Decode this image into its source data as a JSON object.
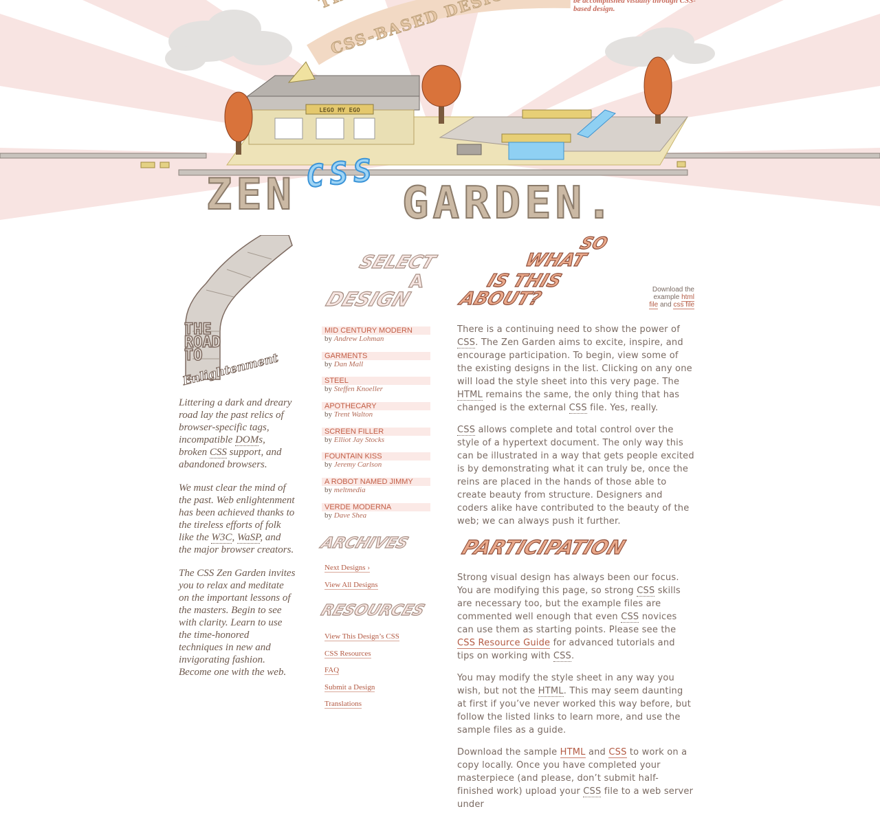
{
  "header": {
    "tagline_small": "be accomplished visually through CSS-based design.",
    "arc_line1": "THE BEAUTY OF CSS DESIGN",
    "arc_line2": "CSS-BASED DESIGN",
    "title_zen": "ZEN",
    "title_css": "CSS",
    "title_garden": "GARDEN.",
    "sign_text": "LEGO MY EGO",
    "colors": {
      "sky_rays": "#f8e4e2",
      "brick_gray": "#b8b0a8",
      "brick_yellow": "#e8d17a",
      "brick_blue": "#8ecdf2",
      "tree_orange": "#d9733b"
    }
  },
  "left": {
    "road_caption": [
      "THE",
      "ROAD",
      "TO"
    ],
    "road_enlight": "Enlightenment",
    "p1_a": "Littering a dark and dreary road lay the past relics of browser-specific tags, incompatible ",
    "p1_dom": "DOM",
    "p1_b": "s, broken ",
    "p1_css": "CSS",
    "p1_c": " support, and abandoned browsers.",
    "p2_a": "We must clear the mind of the past. Web enlightenment has been achieved thanks to the tireless efforts of folk like the ",
    "p2_w3c": "W3C",
    "p2_sep": ", ",
    "p2_wasp": "WaSP",
    "p2_b": ", and the major browser creators.",
    "p3": "The CSS Zen Garden invites you to relax and meditate on the important lessons of the masters. Begin to see with clarity. Learn to use the time-honored techniques in new and invigorating fashion. Become one with the web."
  },
  "mid": {
    "select_heading": [
      "SELECT",
      "A",
      "DESIGN"
    ],
    "by_label": "by",
    "designs": [
      {
        "name": "Mid Century Modern",
        "author": "Andrew Lohman"
      },
      {
        "name": "Garments",
        "author": "Dan Mall"
      },
      {
        "name": "Steel",
        "author": "Steffen Knoeller"
      },
      {
        "name": "Apothecary",
        "author": "Trent Walton"
      },
      {
        "name": "Screen Filler",
        "author": "Elliot Jay Stocks"
      },
      {
        "name": "Fountain Kiss",
        "author": "Jeremy Carlson"
      },
      {
        "name": "A Robot Named Jimmy",
        "author": "meltmedia"
      },
      {
        "name": "Verde Moderna",
        "author": "Dave Shea"
      }
    ],
    "archives_heading": "ARCHIVES",
    "archives_links": [
      "Next Designs ›",
      "View All Designs"
    ],
    "resources_heading": "RESOURCES",
    "resources_links": [
      "View This Design’s CSS",
      "CSS Resources",
      "FAQ",
      "Submit a Design",
      "Translations"
    ]
  },
  "right": {
    "about_heading": [
      "SO",
      "WHAT",
      "IS THIS",
      "ABOUT?"
    ],
    "download": {
      "prefix": "Download the example",
      "html_link": "html file",
      "and": "and",
      "css_link": "css file"
    },
    "p1_a": "There is a continuing need to show the power of ",
    "p1_css": "CSS",
    "p1_b": ". The Zen Garden aims to excite, inspire, and encourage participation. To begin, view some of the existing designs in the list. Clicking on any one will load the style sheet into this very page. The ",
    "p1_html": "HTML",
    "p1_c": " remains the same, the only thing that has changed is the external ",
    "p1_css2": "CSS",
    "p1_d": " file. Yes, really.",
    "p2_css": "CSS",
    "p2_a": " allows complete and total control over the style of a hypertext document. The only way this can be illustrated in a way that gets people excited is by demonstrating what it can truly be, once the reins are placed in the hands of those able to create beauty from structure. Designers and coders alike have contributed to the beauty of the web; we can always push it further.",
    "participation_heading": "PARTICIPATION",
    "p3_a": "Strong visual design has always been our focus. You are modifying this page, so strong ",
    "p3_css": "CSS",
    "p3_b": " skills are necessary too, but the example files are commented well enough that even ",
    "p3_css2": "CSS",
    "p3_c": " novices can use them as starting points. Please see the ",
    "p3_link": "CSS Resource Guide",
    "p3_d": " for advanced tutorials and tips on working with ",
    "p3_css3": "CSS",
    "p3_e": ".",
    "p4_a": "You may modify the style sheet in any way you wish, but not the ",
    "p4_html": "HTML",
    "p4_b": ". This may seem daunting at first if you’ve never worked this way before, but follow the listed links to learn more, and use the sample files as a guide.",
    "p5_a": "Download the sample ",
    "p5_html": "HTML",
    "p5_and": " and ",
    "p5_css": "CSS",
    "p5_b": " to work on a copy locally. Once you have completed your masterpiece (and please, don’t submit half-finished work) upload your ",
    "p5_css2": "CSS",
    "p5_c": " file to a web server under"
  }
}
